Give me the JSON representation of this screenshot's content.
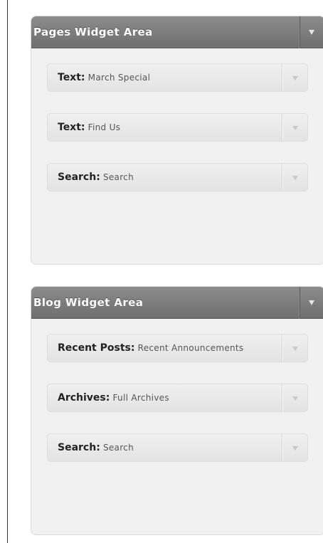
{
  "sidebars": [
    {
      "title": "Pages Widget Area",
      "widgets": [
        {
          "type": "Text",
          "instance": "March Special"
        },
        {
          "type": "Text",
          "instance": "Find Us"
        },
        {
          "type": "Search",
          "instance": "Search"
        }
      ]
    },
    {
      "title": "Blog Widget Area",
      "widgets": [
        {
          "type": "Recent Posts",
          "instance": "Recent Announcements"
        },
        {
          "type": "Archives",
          "instance": "Full Archives"
        },
        {
          "type": "Search",
          "instance": "Search"
        }
      ]
    }
  ],
  "separator": ":",
  "icons": {
    "sidebar_toggle": "triangle-down-icon",
    "widget_toggle": "triangle-down-icon"
  },
  "colors": {
    "header_bg": "#7d7d7d",
    "panel_bg": "#f1f1f1",
    "widget_bg": "#e8e8e8"
  }
}
